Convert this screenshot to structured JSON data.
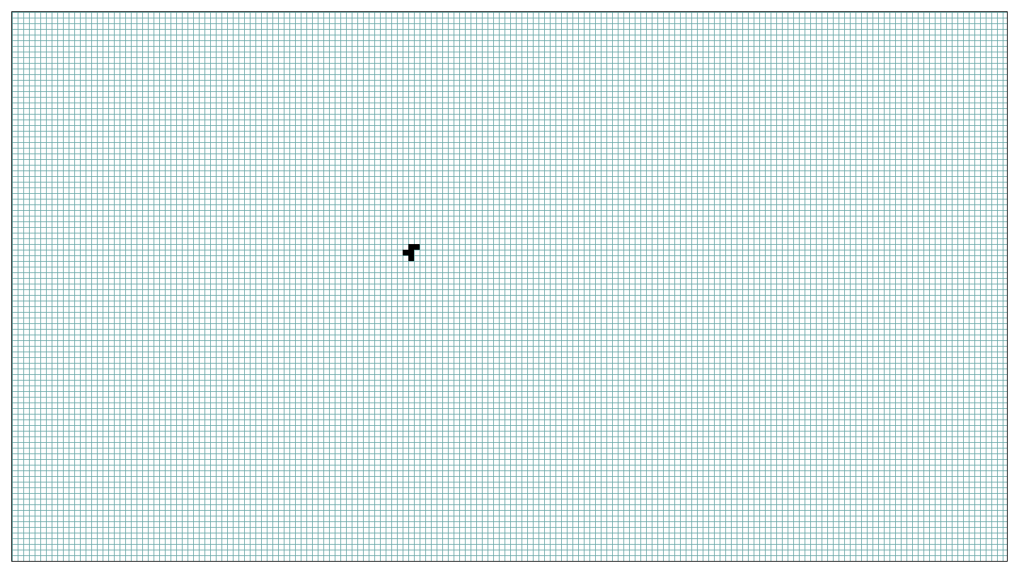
{
  "board": {
    "cell_size_units": 8,
    "cols": 176,
    "rows": 97,
    "grid_color": "#6aa8a8",
    "border_color": "#000000",
    "alive_color": "#000000",
    "background_color": "#ffffff"
  },
  "alive_cells": [
    {
      "col": 70,
      "row": 41
    },
    {
      "col": 71,
      "row": 41
    },
    {
      "col": 69,
      "row": 42
    },
    {
      "col": 70,
      "row": 42
    },
    {
      "col": 70,
      "row": 43
    }
  ]
}
